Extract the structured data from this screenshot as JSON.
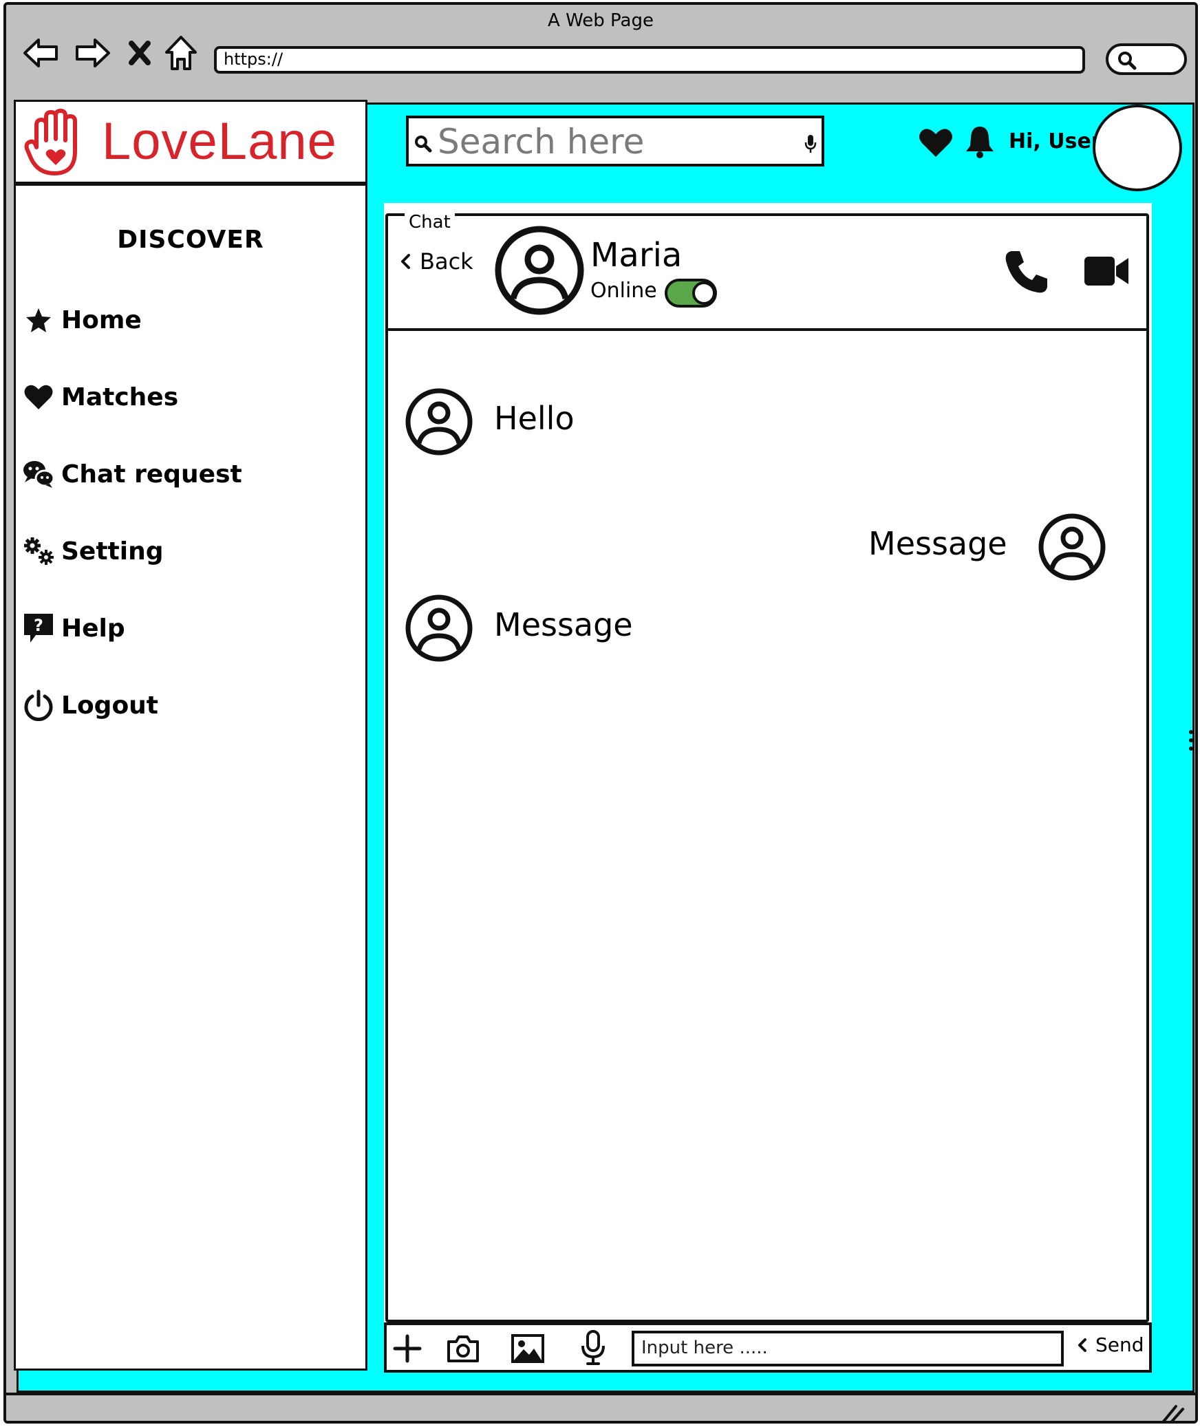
{
  "browser": {
    "window_title": "A Web Page",
    "url": "https://"
  },
  "app": {
    "brand": "LoveLane",
    "brand_color": "#d9232b",
    "background_color": "#00ffff"
  },
  "sidebar": {
    "heading": "DISCOVER",
    "items": [
      {
        "label": "Home",
        "icon": "star-icon"
      },
      {
        "label": "Matches",
        "icon": "heart-icon"
      },
      {
        "label": "Chat request",
        "icon": "chat-bubbles-icon"
      },
      {
        "label": "Setting",
        "icon": "gears-icon"
      },
      {
        "label": "Help",
        "icon": "help-icon"
      },
      {
        "label": "Logout",
        "icon": "power-icon"
      }
    ]
  },
  "header": {
    "search_placeholder": "Search here",
    "greeting": "Hi, User"
  },
  "chat": {
    "legend": "Chat",
    "back_label": "Back",
    "contact_name": "Maria",
    "contact_status": "Online",
    "online_toggle_on": true,
    "messages": [
      {
        "text": "Hello",
        "side": "left"
      },
      {
        "text": "Message",
        "side": "right"
      },
      {
        "text": "Message",
        "side": "left"
      }
    ],
    "composer": {
      "input_value": "Input here .....",
      "send_label": "Send"
    }
  }
}
